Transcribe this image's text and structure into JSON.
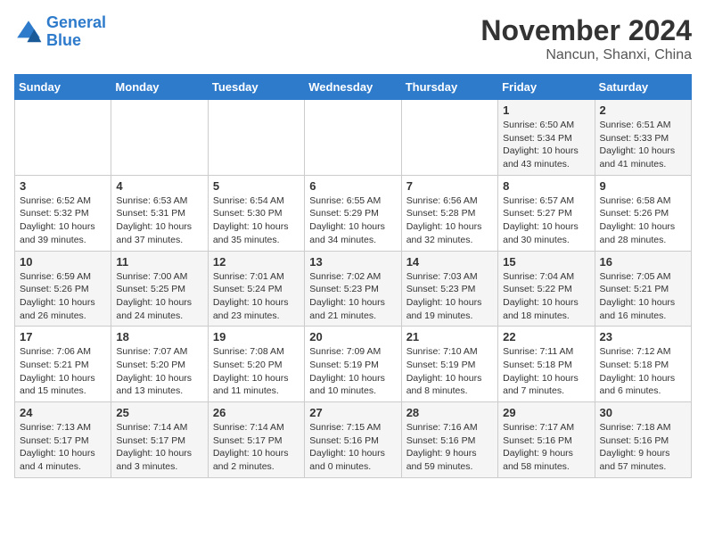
{
  "logo": {
    "line1": "General",
    "line2": "Blue"
  },
  "title": "November 2024",
  "location": "Nancun, Shanxi, China",
  "days_of_week": [
    "Sunday",
    "Monday",
    "Tuesday",
    "Wednesday",
    "Thursday",
    "Friday",
    "Saturday"
  ],
  "weeks": [
    [
      {
        "day": "",
        "info": ""
      },
      {
        "day": "",
        "info": ""
      },
      {
        "day": "",
        "info": ""
      },
      {
        "day": "",
        "info": ""
      },
      {
        "day": "",
        "info": ""
      },
      {
        "day": "1",
        "info": "Sunrise: 6:50 AM\nSunset: 5:34 PM\nDaylight: 10 hours\nand 43 minutes."
      },
      {
        "day": "2",
        "info": "Sunrise: 6:51 AM\nSunset: 5:33 PM\nDaylight: 10 hours\nand 41 minutes."
      }
    ],
    [
      {
        "day": "3",
        "info": "Sunrise: 6:52 AM\nSunset: 5:32 PM\nDaylight: 10 hours\nand 39 minutes."
      },
      {
        "day": "4",
        "info": "Sunrise: 6:53 AM\nSunset: 5:31 PM\nDaylight: 10 hours\nand 37 minutes."
      },
      {
        "day": "5",
        "info": "Sunrise: 6:54 AM\nSunset: 5:30 PM\nDaylight: 10 hours\nand 35 minutes."
      },
      {
        "day": "6",
        "info": "Sunrise: 6:55 AM\nSunset: 5:29 PM\nDaylight: 10 hours\nand 34 minutes."
      },
      {
        "day": "7",
        "info": "Sunrise: 6:56 AM\nSunset: 5:28 PM\nDaylight: 10 hours\nand 32 minutes."
      },
      {
        "day": "8",
        "info": "Sunrise: 6:57 AM\nSunset: 5:27 PM\nDaylight: 10 hours\nand 30 minutes."
      },
      {
        "day": "9",
        "info": "Sunrise: 6:58 AM\nSunset: 5:26 PM\nDaylight: 10 hours\nand 28 minutes."
      }
    ],
    [
      {
        "day": "10",
        "info": "Sunrise: 6:59 AM\nSunset: 5:26 PM\nDaylight: 10 hours\nand 26 minutes."
      },
      {
        "day": "11",
        "info": "Sunrise: 7:00 AM\nSunset: 5:25 PM\nDaylight: 10 hours\nand 24 minutes."
      },
      {
        "day": "12",
        "info": "Sunrise: 7:01 AM\nSunset: 5:24 PM\nDaylight: 10 hours\nand 23 minutes."
      },
      {
        "day": "13",
        "info": "Sunrise: 7:02 AM\nSunset: 5:23 PM\nDaylight: 10 hours\nand 21 minutes."
      },
      {
        "day": "14",
        "info": "Sunrise: 7:03 AM\nSunset: 5:23 PM\nDaylight: 10 hours\nand 19 minutes."
      },
      {
        "day": "15",
        "info": "Sunrise: 7:04 AM\nSunset: 5:22 PM\nDaylight: 10 hours\nand 18 minutes."
      },
      {
        "day": "16",
        "info": "Sunrise: 7:05 AM\nSunset: 5:21 PM\nDaylight: 10 hours\nand 16 minutes."
      }
    ],
    [
      {
        "day": "17",
        "info": "Sunrise: 7:06 AM\nSunset: 5:21 PM\nDaylight: 10 hours\nand 15 minutes."
      },
      {
        "day": "18",
        "info": "Sunrise: 7:07 AM\nSunset: 5:20 PM\nDaylight: 10 hours\nand 13 minutes."
      },
      {
        "day": "19",
        "info": "Sunrise: 7:08 AM\nSunset: 5:20 PM\nDaylight: 10 hours\nand 11 minutes."
      },
      {
        "day": "20",
        "info": "Sunrise: 7:09 AM\nSunset: 5:19 PM\nDaylight: 10 hours\nand 10 minutes."
      },
      {
        "day": "21",
        "info": "Sunrise: 7:10 AM\nSunset: 5:19 PM\nDaylight: 10 hours\nand 8 minutes."
      },
      {
        "day": "22",
        "info": "Sunrise: 7:11 AM\nSunset: 5:18 PM\nDaylight: 10 hours\nand 7 minutes."
      },
      {
        "day": "23",
        "info": "Sunrise: 7:12 AM\nSunset: 5:18 PM\nDaylight: 10 hours\nand 6 minutes."
      }
    ],
    [
      {
        "day": "24",
        "info": "Sunrise: 7:13 AM\nSunset: 5:17 PM\nDaylight: 10 hours\nand 4 minutes."
      },
      {
        "day": "25",
        "info": "Sunrise: 7:14 AM\nSunset: 5:17 PM\nDaylight: 10 hours\nand 3 minutes."
      },
      {
        "day": "26",
        "info": "Sunrise: 7:14 AM\nSunset: 5:17 PM\nDaylight: 10 hours\nand 2 minutes."
      },
      {
        "day": "27",
        "info": "Sunrise: 7:15 AM\nSunset: 5:16 PM\nDaylight: 10 hours\nand 0 minutes."
      },
      {
        "day": "28",
        "info": "Sunrise: 7:16 AM\nSunset: 5:16 PM\nDaylight: 9 hours\nand 59 minutes."
      },
      {
        "day": "29",
        "info": "Sunrise: 7:17 AM\nSunset: 5:16 PM\nDaylight: 9 hours\nand 58 minutes."
      },
      {
        "day": "30",
        "info": "Sunrise: 7:18 AM\nSunset: 5:16 PM\nDaylight: 9 hours\nand 57 minutes."
      }
    ]
  ]
}
